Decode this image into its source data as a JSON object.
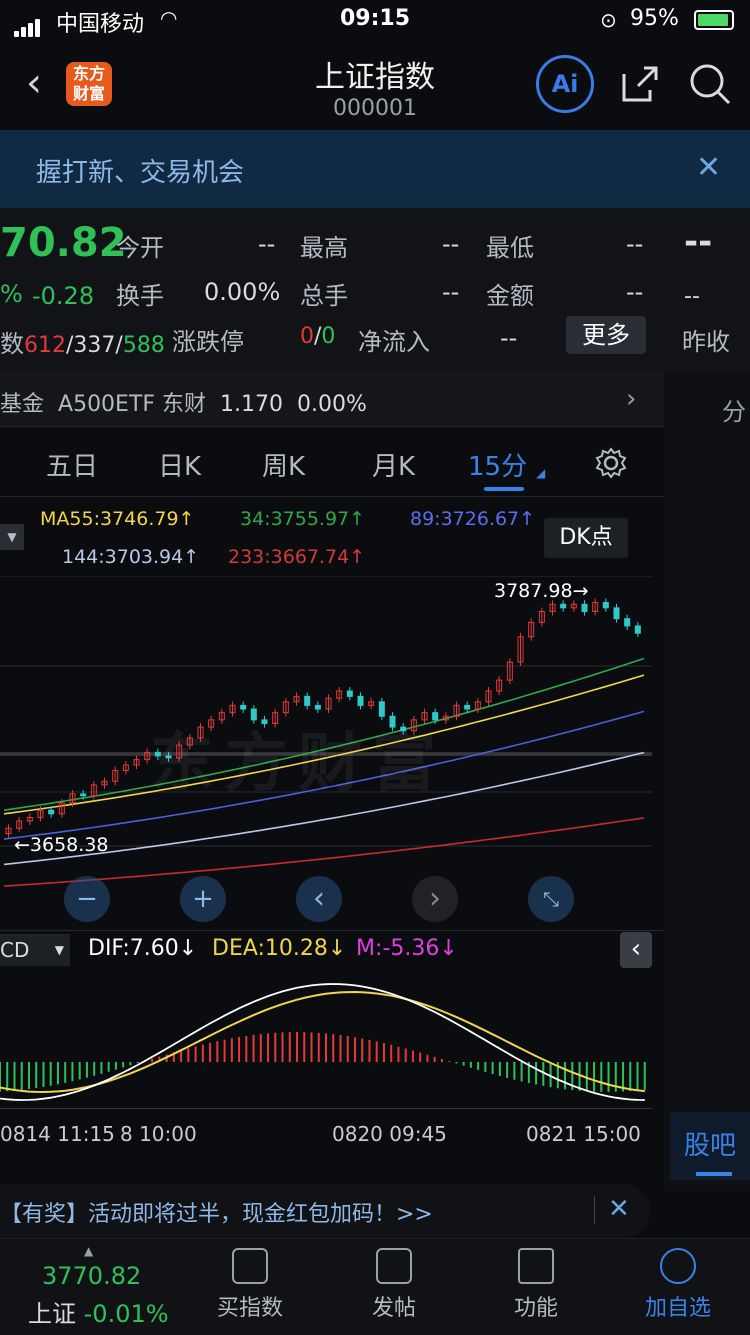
{
  "status_bar": {
    "carrier": "中国移动",
    "time": "09:15",
    "battery": "95%"
  },
  "header": {
    "title": "上证指数",
    "code": "000001",
    "logo_text_1": "东方",
    "logo_text_2": "财富",
    "ai_label": "Ai"
  },
  "banner": {
    "text": "握打新、交易机会"
  },
  "quote": {
    "price": "70.82",
    "pct": "%",
    "change": "-0.28",
    "open_label": "今开",
    "open_val": "--",
    "high_label": "最高",
    "high_val": "--",
    "low_label": "最低",
    "low_val": "--",
    "turnover_label": "换手",
    "turnover_val": "0.00%",
    "vol_label": "总手",
    "vol_val": "--",
    "amount_label": "金额",
    "amount_val": "--",
    "breadth_prefix": "数",
    "breadth_up": "612",
    "sep1": "/",
    "breadth_flat": "337",
    "sep2": "/",
    "breadth_down": "588",
    "limit_label": "涨跌停",
    "limit_up": "0",
    "sep3": "/",
    "limit_down": "0",
    "netflow_label": "净流入",
    "netflow_val": "--",
    "more_label": "更多",
    "right_dash": "--",
    "right_dash2": "--",
    "prev_close_label": "昨收"
  },
  "fund_row": {
    "prefix": "基金",
    "name": "A500ETF 东财",
    "price": "1.170",
    "pct": "0.00%",
    "side_label": "分"
  },
  "tabs": [
    {
      "label": "五日"
    },
    {
      "label": "日K"
    },
    {
      "label": "周K"
    },
    {
      "label": "月K"
    },
    {
      "label": "15分"
    }
  ],
  "ma_legend": {
    "ma55": "MA55:3746.79↑",
    "ma34": "34:3755.97↑",
    "ma89": "89:3726.67↑",
    "ma144": "144:3703.94↑",
    "ma233": "233:3667.74↑",
    "dk_label": "DK点"
  },
  "chart_annotations": {
    "high_label": "3787.98→",
    "low_label": "←3658.38",
    "watermark": "东方财富"
  },
  "macd": {
    "selector": "CD",
    "dif": "DIF:7.60↓",
    "dea": "DEA:10.28↓",
    "m": "M:-5.36↓"
  },
  "time_axis": {
    "t1": "0814 11:15",
    "t2": "8 10:00",
    "t3": "0820 09:45",
    "t4": "0821 15:00"
  },
  "guba_label": "股吧",
  "promo": {
    "text": "【有奖】活动即将过半，现金红包加码！>>"
  },
  "bottom_nav": {
    "index_price": "3770.82",
    "index_name": "上证",
    "index_pct": "-0.01%",
    "items": [
      {
        "label": "买指数"
      },
      {
        "label": "发帖"
      },
      {
        "label": "功能"
      },
      {
        "label": "加自选"
      }
    ]
  },
  "colors": {
    "up": "#e33a3a",
    "down": "#2fc158",
    "accent": "#3b82e8",
    "ma55": "#f1d54a",
    "ma34": "#2fa84a",
    "ma89": "#4a5fd8",
    "ma144": "#b9c7e8",
    "ma233": "#c92a2a"
  },
  "chart_data": {
    "type": "candlestick",
    "interval": "15分",
    "x_labels": [
      "0814 11:15",
      "8 10:00",
      "0820 09:45",
      "0821 15:00"
    ],
    "close": [
      3662,
      3666,
      3668,
      3672,
      3670,
      3676,
      3681,
      3680,
      3686,
      3688,
      3694,
      3697,
      3700,
      3704,
      3702,
      3701,
      3708,
      3712,
      3718,
      3722,
      3726,
      3730,
      3728,
      3722,
      3720,
      3726,
      3732,
      3735,
      3730,
      3728,
      3734,
      3738,
      3735,
      3730,
      3732,
      3724,
      3718,
      3716,
      3722,
      3726,
      3722,
      3724,
      3730,
      3728,
      3732,
      3738,
      3744,
      3754,
      3768,
      3776,
      3782,
      3786,
      3784,
      3786,
      3782,
      3787,
      3784,
      3778,
      3774,
      3770
    ],
    "ma_lines": {
      "MA55": 3746.79,
      "34": 3755.97,
      "89": 3726.67,
      "144": 3703.94,
      "233": 3667.74
    },
    "annotations": {
      "high": 3787.98,
      "low": 3658.38
    }
  }
}
